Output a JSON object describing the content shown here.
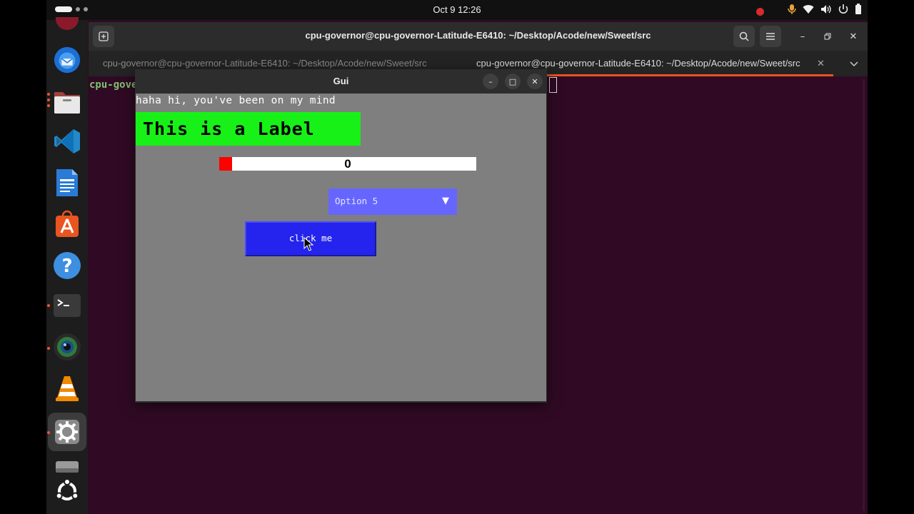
{
  "topbar": {
    "clock": "Oct 9  12:26",
    "icons": [
      "recording-icon",
      "microphone-icon",
      "wifi-icon",
      "volume-icon",
      "battery-icon"
    ]
  },
  "dock": {
    "items": [
      "chromium",
      "thunderbird",
      "files",
      "vscode",
      "writer",
      "app-center",
      "help",
      "terminal",
      "camera",
      "vlc",
      "settings",
      "drive",
      "ubuntu"
    ]
  },
  "terminal": {
    "title": "cpu-governor@cpu-governor-Latitude-E6410: ~/Desktop/Acode/new/Sweet/src",
    "tabs": [
      {
        "label": "cpu-governor@cpu-governor-Latitude-E6410: ~/Desktop/Acode/new/Sweet/src"
      },
      {
        "label": "cpu-governor@cpu-governor-Latitude-E6410: ~/Desktop/Acode/new/Sweet/src"
      }
    ],
    "prompt_fragment": "cpu-gover",
    "accent": "#e95420"
  },
  "gui": {
    "title": "Gui",
    "message": "haha hi, you've been on my mind",
    "label": "This is a Label",
    "label_color": "#17f117",
    "progress": {
      "value": 0,
      "display": "0",
      "fill_fraction": 0.05
    },
    "dropdown": {
      "selected": "Option 5",
      "arrow": "▼"
    },
    "button": {
      "label": "click me",
      "color": "#2424ee"
    },
    "close_glyph": "✕",
    "maximize_glyph": "□",
    "minimize_glyph": "–"
  }
}
